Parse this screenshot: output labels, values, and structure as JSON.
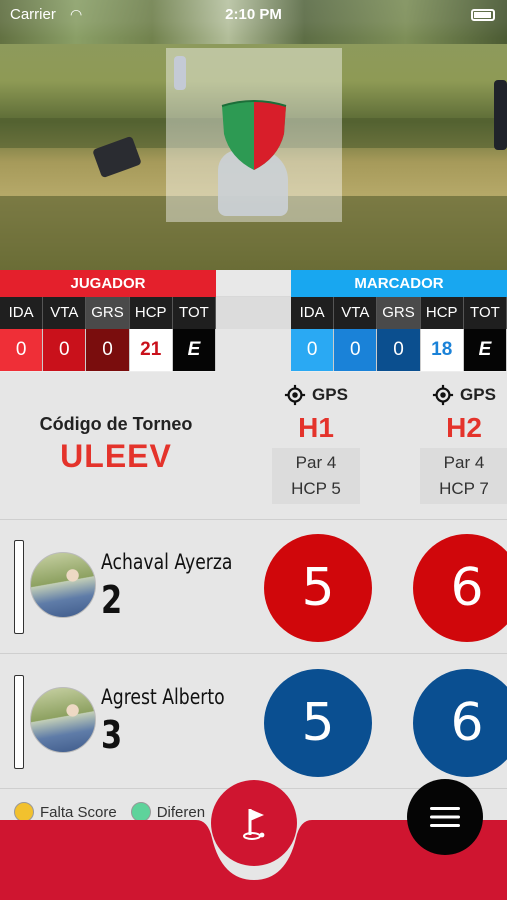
{
  "status": {
    "carrier": "Carrier",
    "time": "2:10 PM"
  },
  "scoreboard": {
    "jugador": {
      "title": "JUGADOR",
      "columns": [
        "IDA",
        "VTA",
        "GRS",
        "HCP",
        "TOT"
      ],
      "values": [
        "0",
        "0",
        "0",
        "21",
        "E"
      ]
    },
    "marcador": {
      "title": "MARCADOR",
      "columns": [
        "IDA",
        "VTA",
        "GRS",
        "HCP",
        "TOT"
      ],
      "values": [
        "0",
        "0",
        "0",
        "18",
        "E"
      ]
    }
  },
  "tournament": {
    "label": "Código de Torneo",
    "code": "ULEEV"
  },
  "holes": [
    {
      "gps": "GPS",
      "name": "H1",
      "par": "Par 4",
      "hcp": "HCP 5"
    },
    {
      "gps": "GPS",
      "name": "H2",
      "par": "Par 4",
      "hcp": "HCP 7"
    }
  ],
  "players": [
    {
      "name": "Achaval Ayerza",
      "hcp": "2",
      "scores": [
        "5",
        "6"
      ],
      "color": "#d0070b"
    },
    {
      "name": "Agrest Alberto",
      "hcp": "3",
      "scores": [
        "5",
        "6"
      ],
      "color": "#0a4f91"
    }
  ],
  "legend": [
    {
      "label": "Falta Score",
      "color": "#f2c12e"
    },
    {
      "label": "Diferen",
      "color": "#5ed39b"
    }
  ],
  "icons": {
    "gps": "gps-target-icon",
    "flag": "golf-flag-icon",
    "menu": "hamburger-menu-icon",
    "shield": "club-shield-logo"
  },
  "colors": {
    "brand_red": "#e4202c",
    "brand_blue": "#18a7f0",
    "bottom_bar": "#cf1530"
  }
}
